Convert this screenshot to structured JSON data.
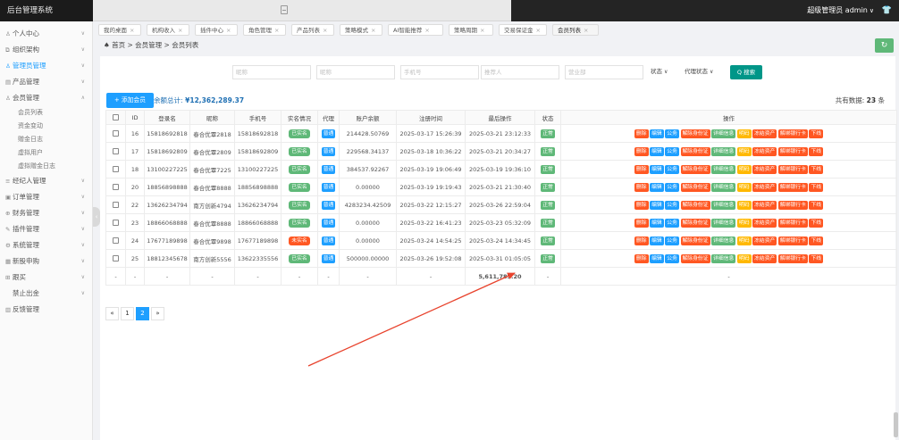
{
  "topbar": {
    "brand": "后台管理系统",
    "user_label": "超级管理员 admin",
    "caret": "∨",
    "shirt_icon": "👕"
  },
  "sidebar": [
    {
      "label": "个人中心",
      "icon": "person-icon",
      "glyph": "♙",
      "chev": "∨"
    },
    {
      "label": "组织架构",
      "icon": "org-icon",
      "glyph": "⧉",
      "chev": "∨"
    },
    {
      "label": "管理员管理",
      "icon": "admin-icon",
      "glyph": "♙",
      "chev": "∨",
      "active": true
    },
    {
      "label": "产品管理",
      "icon": "product-icon",
      "glyph": "▤",
      "chev": "∨"
    },
    {
      "label": "会员管理",
      "icon": "member-icon",
      "glyph": "♙",
      "chev": "∧"
    },
    {
      "label": "会员列表",
      "sub": true
    },
    {
      "label": "资金变动",
      "sub": true
    },
    {
      "label": "赠金日志",
      "sub": true
    },
    {
      "label": "虚拟用户",
      "sub": true
    },
    {
      "label": "虚拟赠金日志",
      "sub": true
    },
    {
      "label": "经纪人管理",
      "icon": "broker-icon",
      "glyph": "≡",
      "chev": "∨"
    },
    {
      "label": "订单管理",
      "icon": "order-icon",
      "glyph": "▣",
      "chev": "∨"
    },
    {
      "label": "财务管理",
      "icon": "finance-icon",
      "glyph": "⊕",
      "chev": "∨"
    },
    {
      "label": "插件管理",
      "icon": "plugin-icon",
      "glyph": "✎",
      "chev": "∨"
    },
    {
      "label": "系统管理",
      "icon": "system-icon",
      "glyph": "⚙",
      "chev": "∨"
    },
    {
      "label": "新股申购",
      "icon": "ipo-icon",
      "glyph": "▦",
      "chev": "∨"
    },
    {
      "label": "跟买",
      "icon": "follow-icon",
      "glyph": "⊞",
      "chev": "∨"
    },
    {
      "label": "禁止出金",
      "icon": "",
      "glyph": "",
      "chev": "∨"
    },
    {
      "label": "反馈管理",
      "icon": "feedback-icon",
      "glyph": "▥",
      "chev": ""
    }
  ],
  "collapse_glyph": "‹",
  "tabs": [
    {
      "label": "我的桌面",
      "x": "×"
    },
    {
      "label": "机构收入",
      "x": "×"
    },
    {
      "label": "插件中心",
      "x": "×"
    },
    {
      "label": "角色管理",
      "x": "×"
    },
    {
      "label": "产品列表",
      "x": "×"
    },
    {
      "label": "策略模式",
      "x": "×"
    },
    {
      "label": "AI智能推荐",
      "x": "×"
    },
    {
      "label": "策略周期",
      "x": "×"
    },
    {
      "label": "交易保证金",
      "x": "×"
    },
    {
      "label": "会员列表",
      "x": "×",
      "active": true
    }
  ],
  "breadcrumb": "首页 > 会员管理 > 会员列表",
  "home_glyph": "♠",
  "refresh_glyph": "↻",
  "filters": {
    "f1": "昵称",
    "f2": "昵称",
    "f3": "手机号",
    "f4": "推荐人",
    "f5": "营业部",
    "status": "状态",
    "agent_status": "代理状态",
    "caret": "∨",
    "search": "Q 搜索"
  },
  "add_button": "+ 添加会员",
  "summary_label": "余额总计:",
  "summary_value": "¥12,362,289.37",
  "total_label": "共有数据:",
  "total_value": "23",
  "total_unit": "条",
  "columns": [
    "",
    "ID",
    "登录名",
    "昵称",
    "手机号",
    "实名情况",
    "代理",
    "账户余额",
    "注册时间",
    "最后操作",
    "状态",
    "操作"
  ],
  "rows": [
    {
      "id": "16",
      "login": "15818692818",
      "nick": "春合优覃2818",
      "phone": "15818692818",
      "real": "已实名",
      "real_ok": true,
      "agent": "普通",
      "balance": "214428.50769",
      "reg": "2025-03-17 15:26:39",
      "last": "2025-03-21 23:12:33",
      "status": "正常"
    },
    {
      "id": "17",
      "login": "15818692809",
      "nick": "春合优覃2809",
      "phone": "15818692809",
      "real": "已实名",
      "real_ok": true,
      "agent": "普通",
      "balance": "229568.34137",
      "reg": "2025-03-18 10:36:22",
      "last": "2025-03-21 20:34:27",
      "status": "正常"
    },
    {
      "id": "18",
      "login": "13100227225",
      "nick": "春合优覃7225",
      "phone": "13100227225",
      "real": "已实名",
      "real_ok": true,
      "agent": "普通",
      "balance": "384537.92267",
      "reg": "2025-03-19 19:06:49",
      "last": "2025-03-19 19:36:10",
      "status": "正常"
    },
    {
      "id": "20",
      "login": "18856898888",
      "nick": "春合优覃8888",
      "phone": "18856898888",
      "real": "已实名",
      "real_ok": true,
      "agent": "普通",
      "balance": "0.00000",
      "reg": "2025-03-19 19:19:43",
      "last": "2025-03-21 21:30:40",
      "status": "正常"
    },
    {
      "id": "22",
      "login": "13626234794",
      "nick": "南方创新4794",
      "phone": "13626234794",
      "real": "已实名",
      "real_ok": true,
      "agent": "普通",
      "balance": "4283234.42509",
      "reg": "2025-03-22 12:15:27",
      "last": "2025-03-26 22:59:04",
      "status": "正常"
    },
    {
      "id": "23",
      "login": "18866068888",
      "nick": "春合优覃8888",
      "phone": "18866068888",
      "real": "已实名",
      "real_ok": true,
      "agent": "普通",
      "balance": "0.00000",
      "reg": "2025-03-22 16:41:23",
      "last": "2025-03-23 05:32:09",
      "status": "正常"
    },
    {
      "id": "24",
      "login": "17677189898",
      "nick": "春合优覃9898",
      "phone": "17677189898",
      "real": "未实名",
      "real_ok": false,
      "agent": "普通",
      "balance": "0.00000",
      "reg": "2025-03-24 14:54:25",
      "last": "2025-03-24 14:34:45",
      "status": "正常"
    },
    {
      "id": "25",
      "login": "18812345678",
      "nick": "南方创新5556",
      "phone": "13622335556",
      "real": "已实名",
      "real_ok": true,
      "agent": "普通",
      "balance": "500000.00000",
      "reg": "2025-03-26 19:52:08",
      "last": "2025-03-31 01:05:05",
      "status": "正常"
    }
  ],
  "ops": [
    {
      "label": "删除",
      "color": "#ff5722"
    },
    {
      "label": "编辑",
      "color": "#1e9fff"
    },
    {
      "label": "公务",
      "color": "#1e9fff"
    },
    {
      "label": "解除身份证",
      "color": "#ff5722"
    },
    {
      "label": "详细信息",
      "color": "#5fb878"
    },
    {
      "label": "明码",
      "color": "#ffb800"
    },
    {
      "label": "冻结资产",
      "color": "#ff5722"
    },
    {
      "label": "解绑银行卡",
      "color": "#ff5722"
    },
    {
      "label": "下线",
      "color": "#ff5722"
    }
  ],
  "footer_row": {
    "dash": "-",
    "last_sum": "5,611,789.20"
  },
  "pager": [
    "«",
    "1",
    "2",
    "»"
  ],
  "colors": {
    "primary": "#1e9fff",
    "success": "#5fb878",
    "danger": "#ff5722",
    "warn": "#ffb800",
    "teal": "#009688",
    "arrow": "#e8432d"
  }
}
